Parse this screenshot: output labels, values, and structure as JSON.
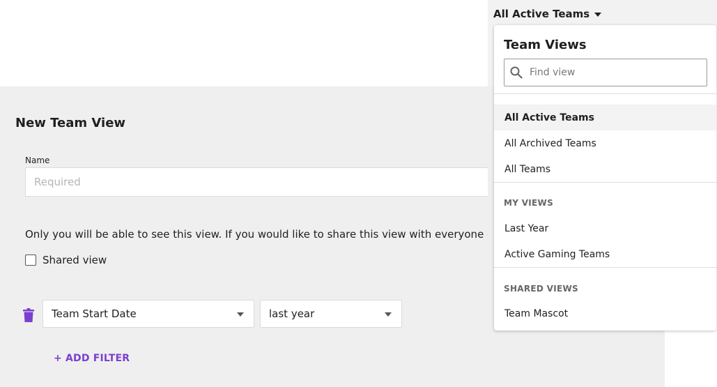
{
  "header": {
    "current_view": "All Active Teams"
  },
  "form": {
    "title": "New Team View",
    "name_label": "Name",
    "name_placeholder": "Required",
    "name_value": "",
    "share_text": "Only you will be able to see this view. If you would like to share this view with everyone else, cl",
    "shared_view_label": "Shared view",
    "shared_view_checked": false,
    "filter": {
      "field": "Team Start Date",
      "value": "last year"
    },
    "add_filter_label": "+ ADD FILTER"
  },
  "dropdown": {
    "title": "Team Views",
    "search_placeholder": "Find view",
    "default_views": [
      "All Active Teams",
      "All Archived Teams",
      "All Teams"
    ],
    "my_views_heading": "MY VIEWS",
    "my_views": [
      "Last Year",
      "Active Gaming Teams"
    ],
    "shared_views_heading": "SHARED VIEWS",
    "shared_views": [
      "Team Mascot"
    ]
  },
  "colors": {
    "accent": "#7b3fd0",
    "panel_background": "#efefef"
  },
  "icons": {
    "trash": "trash-icon",
    "search": "search-icon",
    "caret": "chevron-down-icon"
  }
}
